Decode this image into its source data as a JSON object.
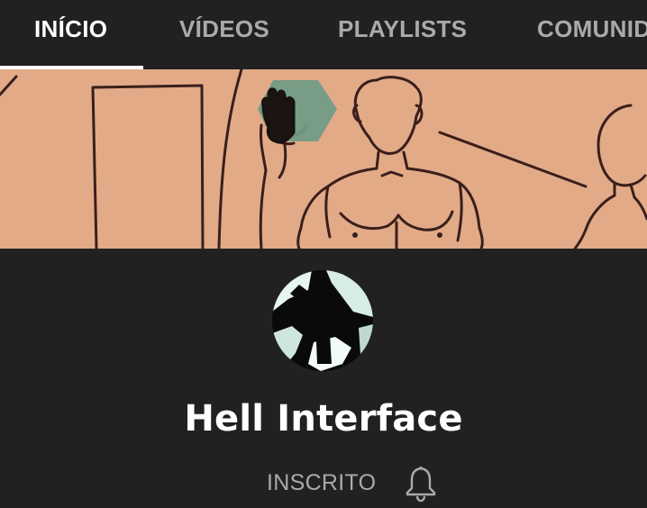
{
  "tabs": [
    {
      "label": "INÍCIO",
      "active": true
    },
    {
      "label": "VÍDEOS",
      "active": false
    },
    {
      "label": "PLAYLISTS",
      "active": false
    },
    {
      "label": "COMUNID",
      "active": false
    }
  ],
  "channel": {
    "name": "Hell Interface",
    "subscribe_status": "INSCRITO",
    "notification_icon": "bell-icon"
  },
  "colors": {
    "background": "#212121",
    "banner": "#e3aa88",
    "active_tab": "#ffffff",
    "inactive_tab": "#aaaaaa",
    "hexagon": "#6f9b85"
  }
}
